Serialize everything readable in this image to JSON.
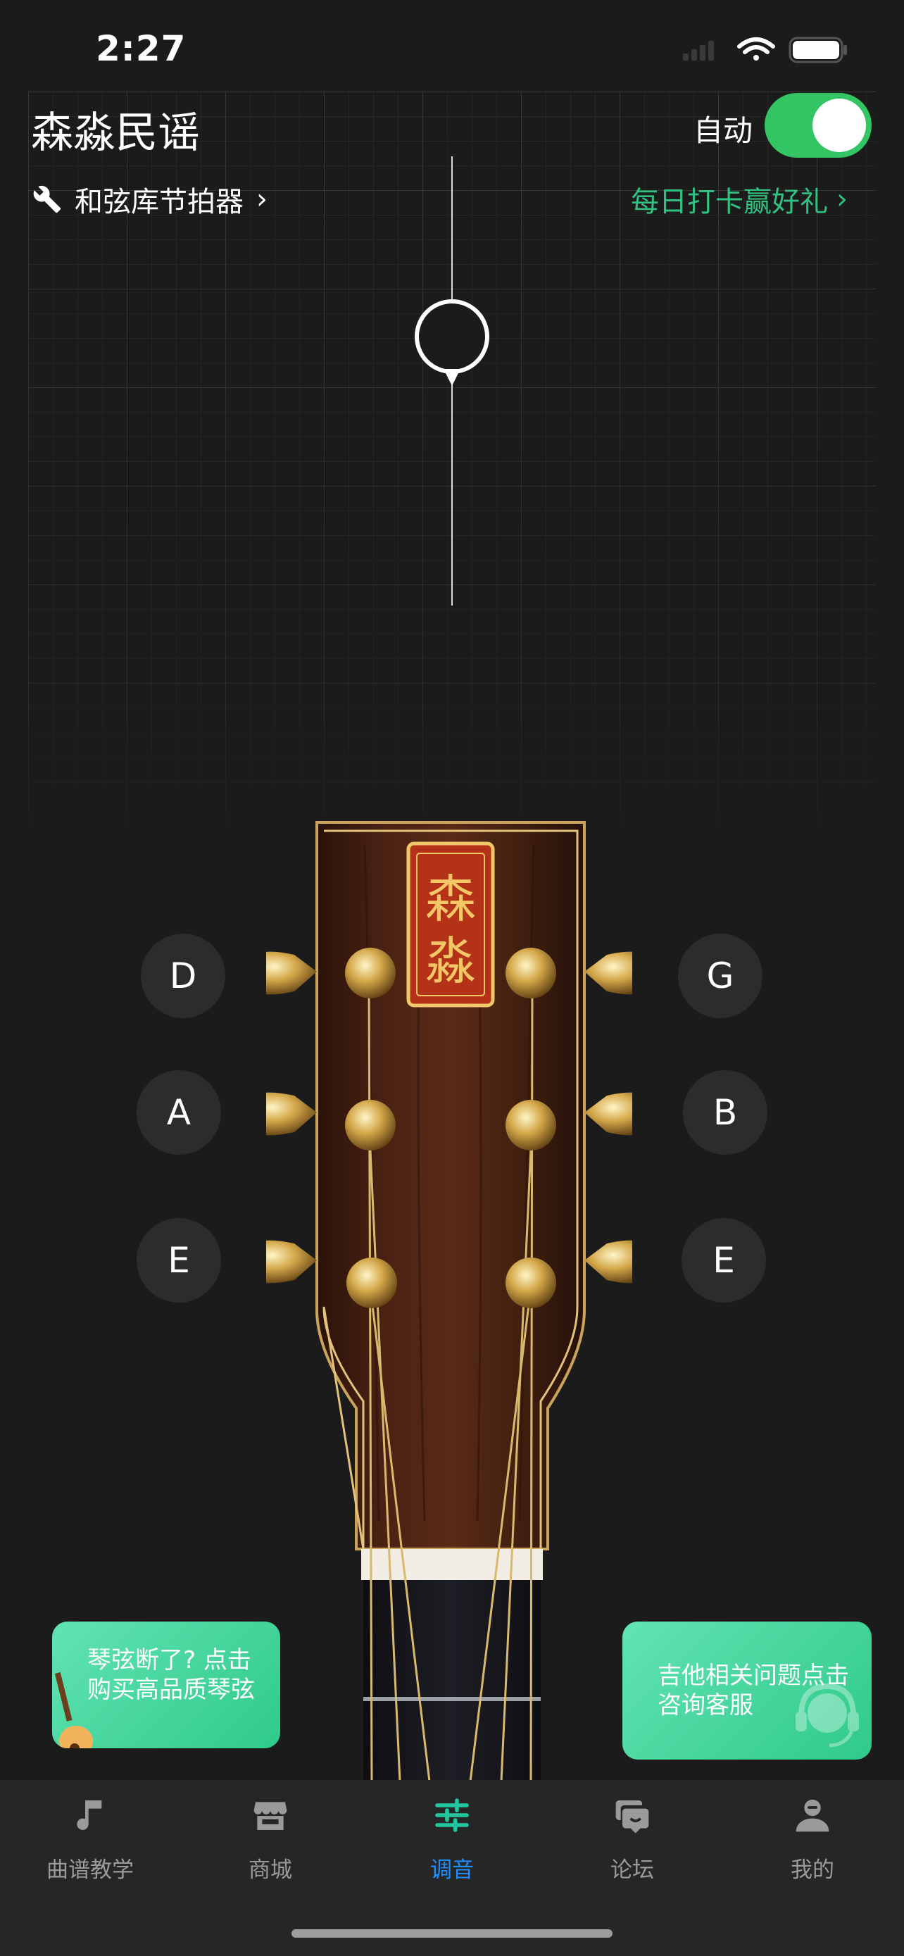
{
  "status_bar": {
    "time": "2:27"
  },
  "header": {
    "title": "森淼民谣",
    "auto_label": "自动",
    "auto_enabled": true,
    "tools_link": "和弦库节拍器",
    "checkin_link": "每日打卡赢好礼"
  },
  "tuner": {
    "string_notes_left": [
      "D",
      "A",
      "E"
    ],
    "string_notes_right": [
      "G",
      "B",
      "E"
    ]
  },
  "promos": {
    "strings": "琴弦断了? 点击 购买高品质琴弦",
    "service": "吉他相关问题点击咨询客服"
  },
  "tabs": [
    {
      "label": "曲谱教学",
      "icon": "music-note-icon"
    },
    {
      "label": "商城",
      "icon": "store-icon"
    },
    {
      "label": "调音",
      "icon": "tuner-sliders-icon",
      "active": true
    },
    {
      "label": "论坛",
      "icon": "forum-chat-icon"
    },
    {
      "label": "我的",
      "icon": "profile-icon"
    }
  ],
  "colors": {
    "background": "#1b1b1b",
    "toggle_on": "#33c563",
    "accent_green": "#32c081",
    "active_tab_blue": "#1e8fff"
  }
}
